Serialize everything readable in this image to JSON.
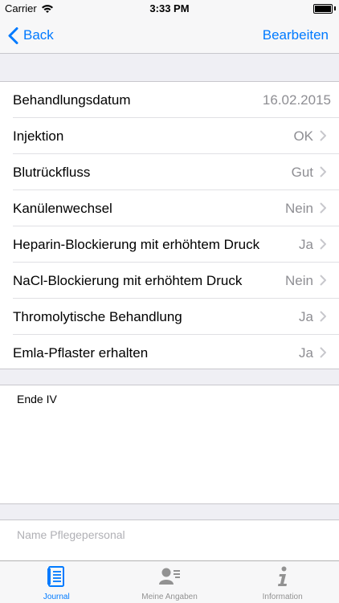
{
  "status_bar": {
    "carrier": "Carrier",
    "time": "3:33 PM"
  },
  "nav": {
    "back_label": "Back",
    "edit_label": "Bearbeiten"
  },
  "rows": [
    {
      "label": "Behandlungsdatum",
      "value": "16.02.2015",
      "chevron": false
    },
    {
      "label": "Injektion",
      "value": "OK",
      "chevron": true
    },
    {
      "label": "Blutrückfluss",
      "value": "Gut",
      "chevron": true
    },
    {
      "label": "Kanülenwechsel",
      "value": "Nein",
      "chevron": true
    },
    {
      "label": "Heparin-Blockierung mit erhöhtem Druck",
      "value": "Ja",
      "chevron": true
    },
    {
      "label": "NaCl-Blockierung mit erhöhtem Druck",
      "value": "Nein",
      "chevron": true
    },
    {
      "label": "Thromolytische Behandlung",
      "value": "Ja",
      "chevron": true
    },
    {
      "label": "Emla-Pflaster erhalten",
      "value": "Ja",
      "chevron": true
    }
  ],
  "note": {
    "text": "Ende IV"
  },
  "nurse": {
    "placeholder": "Name Pflegepersonal"
  },
  "tabs": [
    {
      "label": "Journal",
      "icon": "journal-icon",
      "active": true
    },
    {
      "label": "Meine Angaben",
      "icon": "contact-card-icon",
      "active": false
    },
    {
      "label": "Information",
      "icon": "info-icon",
      "active": false
    }
  ],
  "colors": {
    "accent": "#007aff",
    "secondary_text": "#8e8e93",
    "background": "#efeff4"
  }
}
